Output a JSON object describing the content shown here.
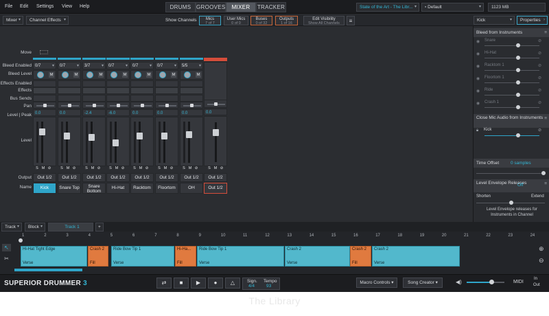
{
  "menu": {
    "file": "File",
    "edit": "Edit",
    "settings": "Settings",
    "view": "View",
    "help": "Help"
  },
  "tabs": {
    "drums": "DRUMS",
    "grooves": "GROOVES",
    "mixer": "MIXER",
    "tracker": "TRACKER"
  },
  "top_right": {
    "kit": "State of the Art - The Libr...",
    "preset": "Default",
    "memory": "1123 MB"
  },
  "toolbar": {
    "mixer_dd": "Mixer",
    "effects_dd": "Channel Effects",
    "show_channels": "Show Channels",
    "mics": "Mics",
    "mics_sub": "7 of 7",
    "user_mics": "User Mics",
    "user_mics_sub": "0 of 0",
    "buses": "Buses",
    "buses_sub": "0 of 32",
    "outputs": "Outputs",
    "outputs_sub": "1 of 16",
    "edit_vis": "Edit Visibility",
    "edit_vis_sub": "Show All Channels",
    "kick_dd": "Kick",
    "properties": "Properties"
  },
  "rows": {
    "move": "Move",
    "bleed_enabled": "Bleed Enabled",
    "bleed_level": "Bleed Level",
    "effects_enabled": "Effects Enabled",
    "effects": "Effects",
    "bus_sends": "Bus Sends",
    "pan": "Pan",
    "level_peak": "Level | Peak",
    "level": "Level",
    "output": "Output",
    "name": "Name"
  },
  "channels": [
    {
      "bleed": "0/7",
      "peak": "0.0",
      "out": "Out 1/2",
      "name": "Kick",
      "selected": true
    },
    {
      "bleed": "0/7",
      "peak": "0.0",
      "out": "Out 1/2",
      "name": "Snare Top"
    },
    {
      "bleed": "3/7",
      "peak": "-2.4",
      "out": "Out 1/2",
      "name": "Snare Bottom"
    },
    {
      "bleed": "0/7",
      "peak": "-6.0",
      "out": "Out 1/2",
      "name": "Hi-Hat"
    },
    {
      "bleed": "0/7",
      "peak": "0.0",
      "out": "Out 1/2",
      "name": "Racktom"
    },
    {
      "bleed": "0/7",
      "peak": "0.0",
      "out": "Out 1/2",
      "name": "Floortom"
    },
    {
      "bleed": "5/5",
      "peak": "0.0",
      "out": "Out 1/2",
      "name": "OH"
    }
  ],
  "master": {
    "peak": "0.0",
    "out": "Out 1/2",
    "name": "Out 1/2"
  },
  "panel": {
    "bleed_title": "Bleed from Instruments",
    "bleed_items": [
      "Snare",
      "Hi-Hat",
      "Racktom 1",
      "Floortom 1",
      "Ride",
      "Crash 1"
    ],
    "close_title": "Close Mic Audio from Instruments",
    "close_item": "Kick",
    "time_offset": "Time Offset",
    "time_offset_val": "0 samples",
    "env_title": "Level Envelope Releases",
    "env_state": "Off",
    "shorten": "Shorten",
    "extend": "Extend",
    "env_desc": "Level Envelope releases for Instruments in Channel"
  },
  "track": {
    "track_dd": "Track",
    "block_dd": "Block",
    "track_name": "Track 1",
    "add": "+"
  },
  "ruler": [
    "1",
    "2",
    "3",
    "4",
    "5",
    "6",
    "7",
    "8",
    "9",
    "10",
    "11",
    "12",
    "13",
    "14",
    "15",
    "16",
    "17",
    "18",
    "19",
    "20",
    "21",
    "22",
    "23",
    "24"
  ],
  "clips": [
    {
      "title": "Hi-Hat Tight Edge",
      "label": "Verse",
      "color": "blue"
    },
    {
      "title": "Crash 2",
      "label": "Fill",
      "color": "orange"
    },
    {
      "title": "Ride Bow Tip 1",
      "label": "Verse",
      "color": "blue"
    },
    {
      "title": "Hi-Ha...",
      "label": "Fill",
      "color": "orange"
    },
    {
      "title": "Ride Bow Tip 1",
      "label": "Verse",
      "color": "blue"
    },
    {
      "title": "Crash 2",
      "label": "Verse",
      "color": "blue"
    },
    {
      "title": "Crash 2",
      "label": "Fill",
      "color": "orange"
    },
    {
      "title": "Crash 2",
      "label": "Verse",
      "color": "blue"
    }
  ],
  "bottom": {
    "brand": "SUPERIOR DRUMMER",
    "brand_num": "3",
    "sign_label": "Sign.",
    "sign_val": "4/4",
    "tempo_label": "Tempo",
    "tempo_val": "93",
    "macro": "Macro Controls",
    "song": "Song Creator",
    "midi": "MIDI",
    "in": "In",
    "out": "Out"
  },
  "footer": "The Library",
  "colors": {
    "accent": "#2fa5c9",
    "clip_blue": "#52b8cc",
    "clip_orange": "#e07a3f",
    "master_red": "#d54d3a"
  }
}
